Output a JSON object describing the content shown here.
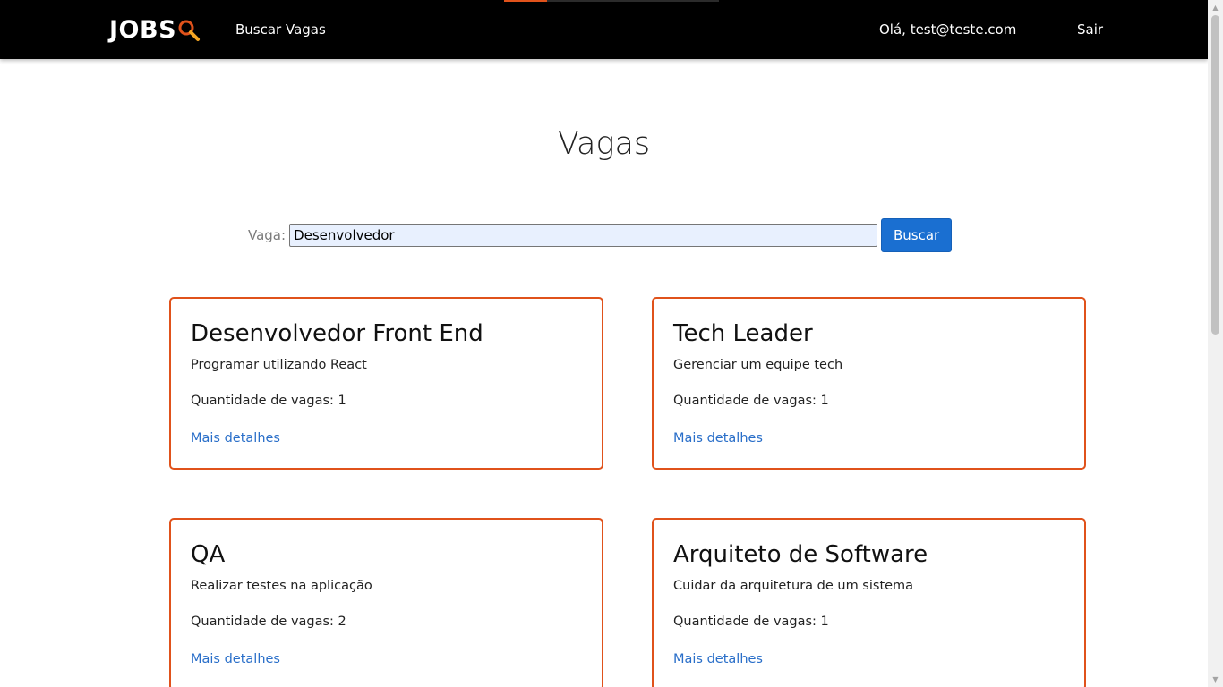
{
  "navbar": {
    "logo_text": "JOBS",
    "search_link": "Buscar Vagas",
    "user_greeting": "Olá, test@teste.com",
    "logout_link": "Sair",
    "loading_progress": 0.2
  },
  "colors": {
    "accent": "#e0521b",
    "primary_button": "#1a6fd1",
    "link": "#2a6fc9",
    "navbar_bg": "#000000",
    "input_bg": "#e8f0fe"
  },
  "page": {
    "title": "Vagas"
  },
  "search": {
    "label": "Vaga:",
    "value": "Desenvolvedor",
    "button_label": "Buscar"
  },
  "jobs": [
    {
      "title": "Desenvolvedor Front End",
      "description": "Programar utilizando React",
      "quantity_text": "Quantidade de vagas: 1",
      "details_link": "Mais detalhes"
    },
    {
      "title": "Tech Leader",
      "description": "Gerenciar um equipe tech",
      "quantity_text": "Quantidade de vagas: 1",
      "details_link": "Mais detalhes"
    },
    {
      "title": "QA",
      "description": "Realizar testes na aplicação",
      "quantity_text": "Quantidade de vagas: 2",
      "details_link": "Mais detalhes"
    },
    {
      "title": "Arquiteto de Software",
      "description": "Cuidar da arquitetura de um sistema",
      "quantity_text": "Quantidade de vagas: 1",
      "details_link": "Mais detalhes"
    }
  ]
}
